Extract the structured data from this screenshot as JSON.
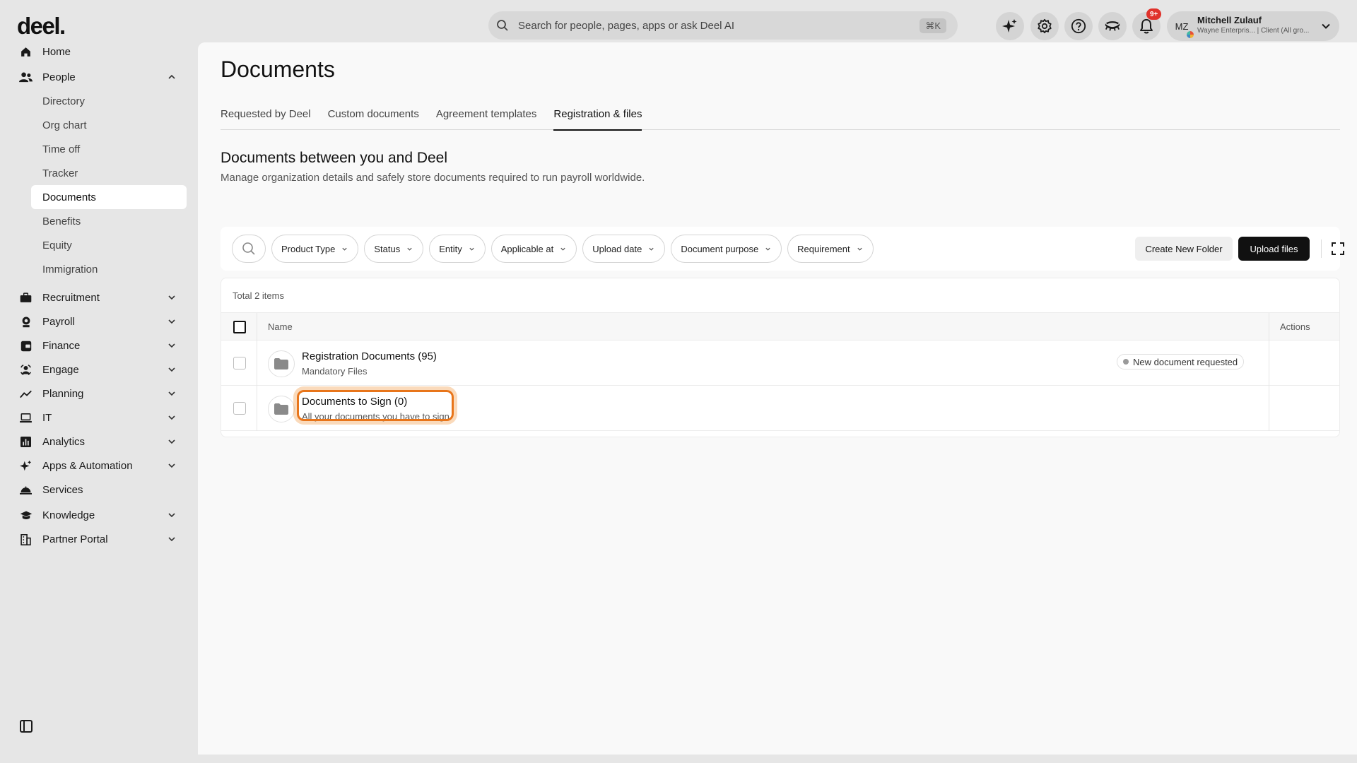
{
  "app": {
    "logo": "deel."
  },
  "sidebar": {
    "items": [
      {
        "label": "Home",
        "icon": "home-icon"
      },
      {
        "label": "People",
        "icon": "people-icon",
        "expanded": true,
        "children": [
          "Directory",
          "Org chart",
          "Time off",
          "Tracker",
          "Documents",
          "Benefits",
          "Equity",
          "Immigration"
        ],
        "active_child": "Documents"
      },
      {
        "label": "Recruitment",
        "icon": "briefcase-icon"
      },
      {
        "label": "Payroll",
        "icon": "payroll-icon"
      },
      {
        "label": "Finance",
        "icon": "finance-icon"
      },
      {
        "label": "Engage",
        "icon": "engage-icon"
      },
      {
        "label": "Planning",
        "icon": "planning-icon"
      },
      {
        "label": "IT",
        "icon": "laptop-icon"
      },
      {
        "label": "Analytics",
        "icon": "analytics-icon"
      },
      {
        "label": "Apps & Automation",
        "icon": "sparkle-icon"
      },
      {
        "label": "Services",
        "icon": "services-icon"
      },
      {
        "label": "Knowledge",
        "icon": "graduation-cap-icon"
      },
      {
        "label": "Partner Portal",
        "icon": "building-icon"
      }
    ]
  },
  "topbar": {
    "search_placeholder": "Search for people, pages, apps or ask Deel AI",
    "search_shortcut": "⌘K",
    "notification_badge": "9+",
    "user": {
      "initials": "MZ",
      "name": "Mitchell Zulauf",
      "subtitle": "Wayne Enterpris... | Client (All gro..."
    }
  },
  "page": {
    "title": "Documents",
    "tabs": [
      "Requested by Deel",
      "Custom documents",
      "Agreement templates",
      "Registration & files"
    ],
    "active_tab": "Registration & files",
    "section_title": "Documents between you and Deel",
    "section_desc": "Manage organization details and safely store documents required to run payroll worldwide."
  },
  "filters": {
    "chips": [
      "Product Type",
      "Status",
      "Entity",
      "Applicable at",
      "Upload date",
      "Document purpose",
      "Requirement"
    ],
    "create_folder_label": "Create New Folder",
    "upload_label": "Upload files"
  },
  "table": {
    "total": "Total 2 items",
    "columns": {
      "name": "Name",
      "actions": "Actions"
    },
    "rows": [
      {
        "title": "Registration Documents (95)",
        "subtitle": "Mandatory Files",
        "status": "New document requested"
      },
      {
        "title": "Documents to Sign (0)",
        "subtitle": "All your documents you have to sign",
        "status": ""
      }
    ]
  },
  "colors": {
    "accent_dark": "#111111",
    "highlight": "#e8751a",
    "badge": "#e0322b"
  }
}
